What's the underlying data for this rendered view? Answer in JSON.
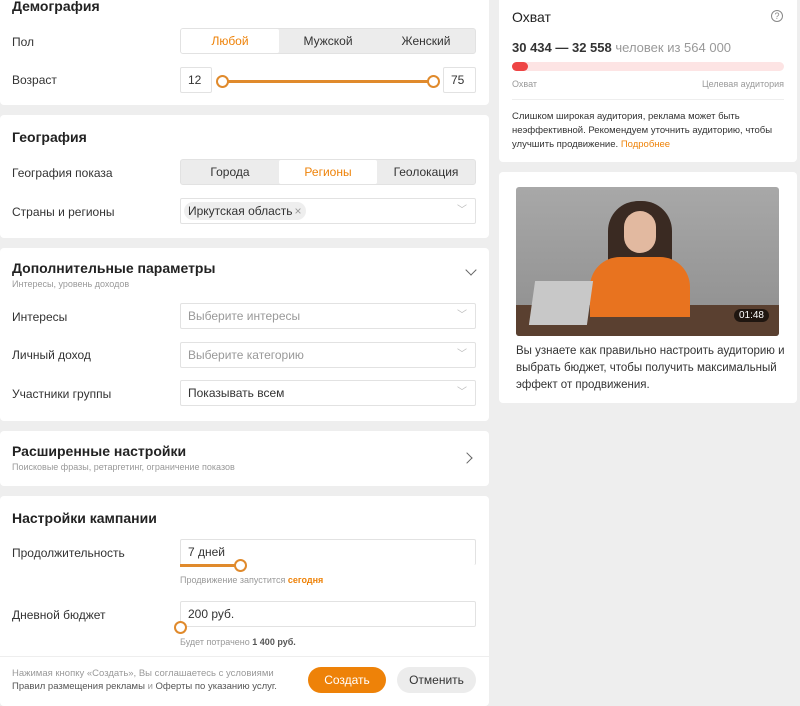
{
  "demography": {
    "title": "Демография",
    "gender_label": "Пол",
    "gender_options": [
      "Любой",
      "Мужской",
      "Женский"
    ],
    "age_label": "Возраст",
    "age_min": "12",
    "age_max": "75"
  },
  "geography": {
    "title": "География",
    "show_label": "География показа",
    "show_options": [
      "Города",
      "Регионы",
      "Геолокация"
    ],
    "regions_label": "Страны и регионы",
    "region_tag": "Иркутская область"
  },
  "extra": {
    "title": "Дополнительные параметры",
    "subtitle": "Интересы, уровень доходов",
    "interests_label": "Интересы",
    "interests_placeholder": "Выберите интересы",
    "income_label": "Личный доход",
    "income_placeholder": "Выберите категорию",
    "group_label": "Участники группы",
    "group_value": "Показывать всем"
  },
  "advanced": {
    "title": "Расширенные настройки",
    "subtitle": "Поисковые фразы, ретаргетинг, ограничение показов"
  },
  "campaign": {
    "title": "Настройки кампании",
    "duration_label": "Продолжительность",
    "duration_value": "7 дней",
    "duration_hint": "Продвижение запустится",
    "duration_hint_accent": "сегодня",
    "budget_label": "Дневной бюджет",
    "budget_value": "200 руб.",
    "budget_hint": "Будет потрачено",
    "budget_hint_bold": "1 400 руб."
  },
  "footer": {
    "terms_line1": "Нажимая кнопку «Создать», Вы соглашаетесь с условиями",
    "terms_line2_a": "Правил размещения рекламы",
    "terms_line2_b": "и",
    "terms_line2_c": "Оферты по указанию услуг.",
    "create_label": "Создать",
    "cancel_label": "Отменить"
  },
  "reach": {
    "title": "Охват",
    "range": "30 434 — 32 558",
    "suffix": "человек из 564 000",
    "progress_percent": 2,
    "left_caption": "Охват",
    "right_caption": "Целевая аудитория",
    "warning": "Слишком широкая аудитория, реклама может быть неэффективной. Рекомендуем уточнить аудиторию, чтобы улучшить продвижение.",
    "more_link": "Подробнее"
  },
  "video": {
    "duration": "01:48",
    "description": "Вы узнаете как правильно настроить аудиторию и выбрать бюджет, чтобы получить максимальный эффект от продвижения."
  }
}
